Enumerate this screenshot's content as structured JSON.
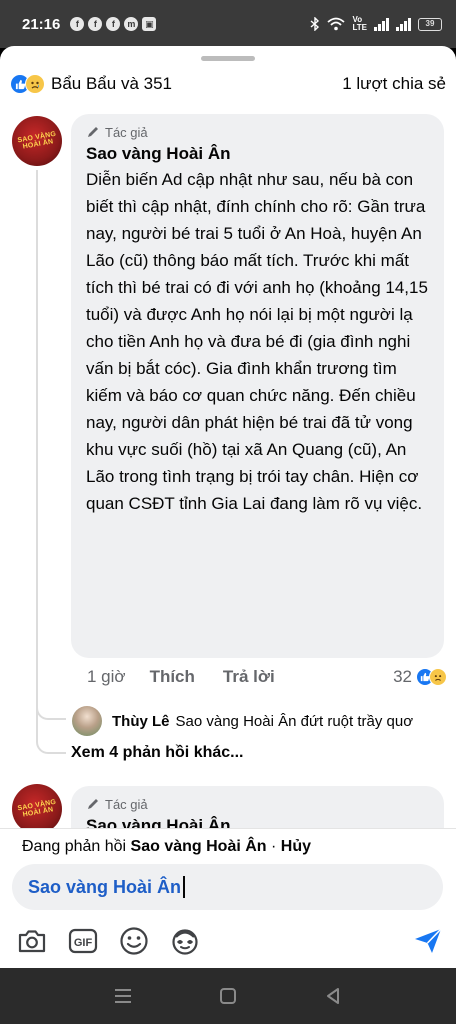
{
  "status_bar": {
    "time": "21:16",
    "network_label_top": "Vo",
    "network_label_bottom": "LTE",
    "battery": "39"
  },
  "reactions": {
    "names": "Bẩu Bẩu và 351",
    "shares": "1 lượt chia sẻ"
  },
  "comment_main": {
    "badge": "Tác giả",
    "author": "Sao vàng Hoài Ân",
    "text": "Diễn biến Ad cập nhật như sau, nếu bà con biết thì cập nhật, đính chính cho rõ: Gần trưa nay, người bé trai 5 tuổi ở An Hoà, huyện An Lão (cũ) thông báo mất tích. Trước khi mất tích thì bé trai có đi với anh họ (khoảng 14,15 tuổi) và được Anh họ nói lại bị một người lạ cho tiền Anh họ và đưa bé đi (gia đình nghi vấn bị bắt cóc). Gia đình khẩn trương tìm kiếm và báo cơ quan chức năng. Đến chiều nay, người dân phát hiện bé trai đã tử vong khu vực suối (hồ) tại xã An Quang (cũ), An Lão trong tình trạng bị trói tay chân. Hiện cơ quan CSĐT tỉnh Gia Lai đang làm rõ vụ việc.",
    "time": "1 giờ",
    "like_label": "Thích",
    "reply_label": "Trả lời",
    "reaction_count": "32",
    "avatar_logo_line1": "SAO VÀNG",
    "avatar_logo_line2": "HOÀI ÂN"
  },
  "reply_preview": {
    "author": "Thùy Lê",
    "text": "Sao vàng Hoài Ân đứt ruột trầy quơ"
  },
  "more_replies": "Xem 4 phản hồi khác...",
  "comment_second": {
    "badge": "Tác giả",
    "author": "Sao vàng Hoài Ân"
  },
  "composer": {
    "replying_prefix": "Đang phản hồi",
    "replying_to": "Sao vàng Hoài Ân",
    "separator": " · ",
    "cancel": "Hủy",
    "mention": "Sao vàng Hoài Ân",
    "tools": [
      "camera-icon",
      "gif-icon",
      "emoji-icon",
      "avatar-sticker-icon",
      "send-icon"
    ]
  },
  "colors": {
    "link_blue": "#1e5ec7",
    "like_blue": "#1877f2",
    "bubble_gray": "#eff0f2"
  }
}
